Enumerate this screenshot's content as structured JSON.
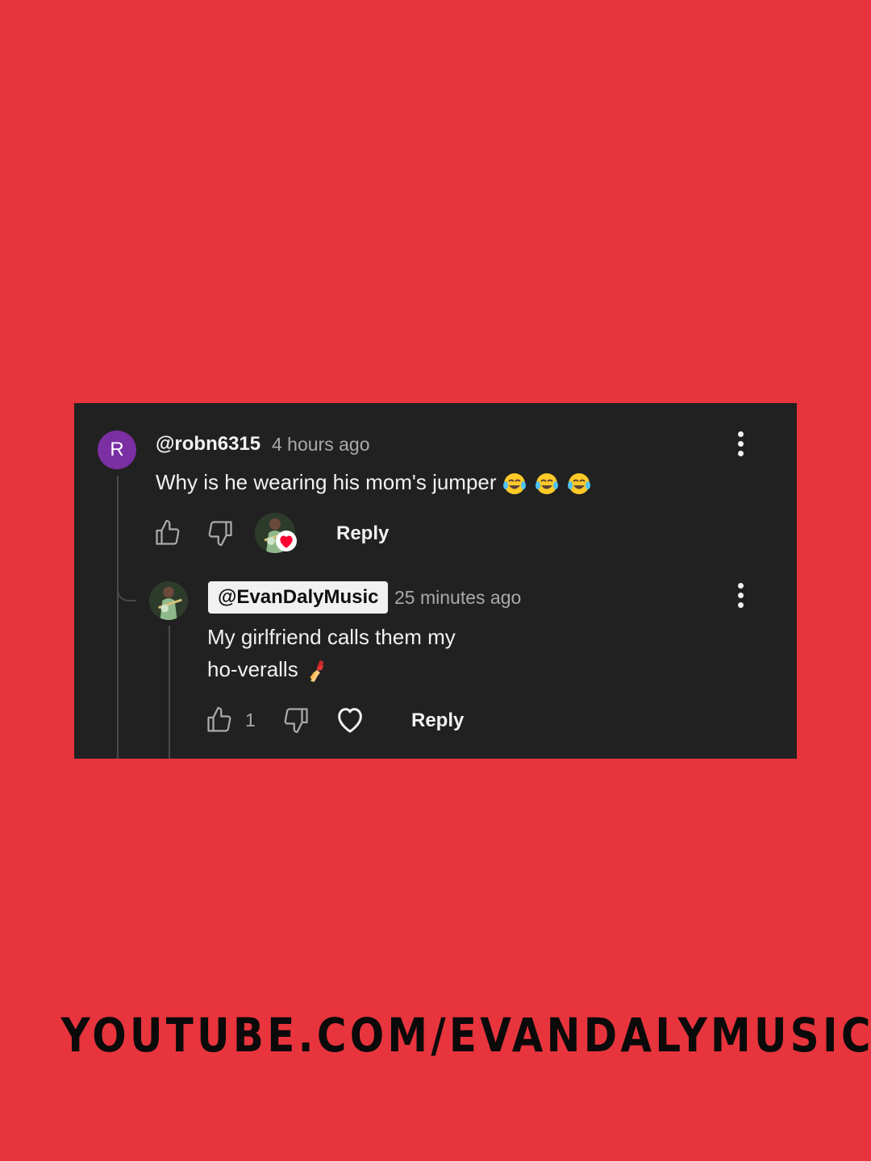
{
  "comment": {
    "avatar_letter": "R",
    "username": "@robn6315",
    "timestamp": "4 hours ago",
    "text": "Why is he wearing his mom's jumper",
    "emojis": [
      "face-with-tears-of-joy",
      "face-with-tears-of-joy",
      "face-with-tears-of-joy"
    ],
    "reply_label": "Reply"
  },
  "reply": {
    "channel": "@EvanDalyMusic",
    "timestamp": "25 minutes ago",
    "text_line1": "My girlfriend calls them my",
    "text_line2": "ho-veralls",
    "emoji": "nail-polish",
    "like_count": "1",
    "reply_label": "Reply"
  },
  "footer": {
    "text": "YOUTUBE.COM/EVANDALYMUSIC"
  },
  "colors": {
    "background": "#e8343d",
    "card": "#212121",
    "avatar_purple": "#7b2fa3",
    "heart_red": "#ff0033"
  }
}
